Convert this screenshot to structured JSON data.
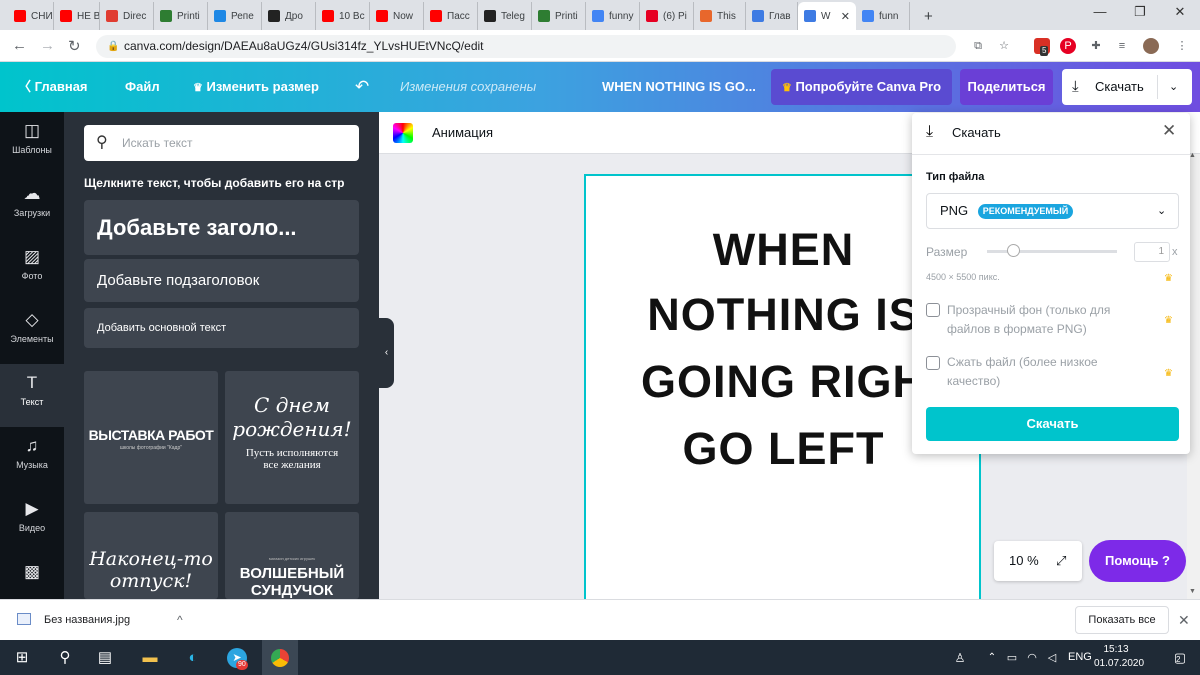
{
  "browser": {
    "tabs": [
      {
        "label": "СНИ",
        "icon": "youtube-icon",
        "color": "#ff0000"
      },
      {
        "label": "НЕ В",
        "icon": "youtube-icon",
        "color": "#ff0000"
      },
      {
        "label": "Direc",
        "icon": "s-brand-icon",
        "color": "#e03c31"
      },
      {
        "label": "Printi",
        "icon": "mountain-icon",
        "color": "#2e7d32"
      },
      {
        "label": "Репе",
        "icon": "triangle-icon",
        "color": "#1e88e5"
      },
      {
        "label": "Дро",
        "icon": "t-icon",
        "color": "#222222"
      },
      {
        "label": "10 Вс",
        "icon": "youtube-icon",
        "color": "#ff0000"
      },
      {
        "label": "Now",
        "icon": "youtube-icon",
        "color": "#ff0000"
      },
      {
        "label": "Пасс",
        "icon": "youtube-icon",
        "color": "#ff0000"
      },
      {
        "label": "Teleg",
        "icon": "t-icon",
        "color": "#222222"
      },
      {
        "label": "Printi",
        "icon": "mountain-icon",
        "color": "#2e7d32"
      },
      {
        "label": "funny",
        "icon": "google-icon",
        "color": "#4285f4"
      },
      {
        "label": "(6) Pi",
        "icon": "pinterest-icon",
        "color": "#e60023"
      },
      {
        "label": "This",
        "icon": "e-icon",
        "color": "#e8672c"
      },
      {
        "label": "Глав",
        "icon": "canva-icon",
        "color": "#3e7be3"
      },
      {
        "label": "W",
        "icon": "canva-icon",
        "color": "#3e7be3"
      },
      {
        "label": "funn",
        "icon": "google-icon",
        "color": "#4285f4"
      }
    ],
    "new_tab": "+",
    "url": "canva.com/design/DAEAu8aUGz4/GUsi314fz_YLvsHUEtVNcQ/edit",
    "ext_badge": "5"
  },
  "header": {
    "home": "Главная",
    "file": "Файл",
    "resize": "Изменить размер",
    "saved": "Изменения сохранены",
    "title": "WHEN NOTHING IS GO...",
    "pro": "Попробуйте Canva Pro",
    "share": "Поделиться",
    "download": "Скачать"
  },
  "rail": [
    {
      "label": "Шаблоны",
      "icon": "layout-icon"
    },
    {
      "label": "Загрузки",
      "icon": "upload-cloud-icon"
    },
    {
      "label": "Фото",
      "icon": "image-icon"
    },
    {
      "label": "Элементы",
      "icon": "shapes-icon"
    },
    {
      "label": "Текст",
      "icon": "text-t-icon"
    },
    {
      "label": "Музыка",
      "icon": "music-note-icon"
    },
    {
      "label": "Видео",
      "icon": "video-icon"
    }
  ],
  "panel": {
    "search_placeholder": "Искать текст",
    "hint": "Щелкните текст, чтобы добавить его на стр",
    "heading": "Добавьте заголо...",
    "subheading": "Добавьте подзаголовок",
    "body": "Добавить основной текст",
    "cards": {
      "c1_title": "ВЫСТАВКА РАБОТ",
      "c1_sub": "школы фотографии \"Кадр\"",
      "c2_title_line1": "С днем",
      "c2_title_line2": "рождения!",
      "c2_sub_line1": "Пусть исполняются",
      "c2_sub_line2": "все желания",
      "c3_line1": "Наконец-то",
      "c3_line2": "отпуск!",
      "c4_small": "магазин детских игрушек",
      "c4_line1": "ВОЛШЕБНЫЙ",
      "c4_line2": "СУНДУЧОК"
    }
  },
  "workspace": {
    "animation": "Анимация",
    "page_lines": [
      "WHEN",
      "NOTHING IS",
      "GOING RIGH",
      "GO LEFT"
    ],
    "zoom": "10 %",
    "help": "Помощь ?"
  },
  "download_panel": {
    "title": "Скачать",
    "file_type_label": "Тип файла",
    "file_type": "PNG",
    "recommended": "РЕКОМЕНДУЕМЫЙ",
    "size_label": "Размер",
    "size_value": "1",
    "size_suffix": "x",
    "dimensions": "4500 × 5500 пикс.",
    "opt_transparent": "Прозрачный фон (только для файлов в формате PNG)",
    "opt_compress": "Сжать файл (более низкое качество)",
    "button": "Скачать"
  },
  "shelf": {
    "file": "Без названия.jpg",
    "show_all": "Показать все"
  },
  "taskbar": {
    "lang": "ENG",
    "time": "15:13",
    "date": "01.07.2020",
    "telegram_badge": "90",
    "notif_count": "2"
  },
  "colors": {
    "accent": "#00c4cc",
    "purple": "#7d2ae8",
    "rail": "#0e1318",
    "panel": "#293039"
  }
}
